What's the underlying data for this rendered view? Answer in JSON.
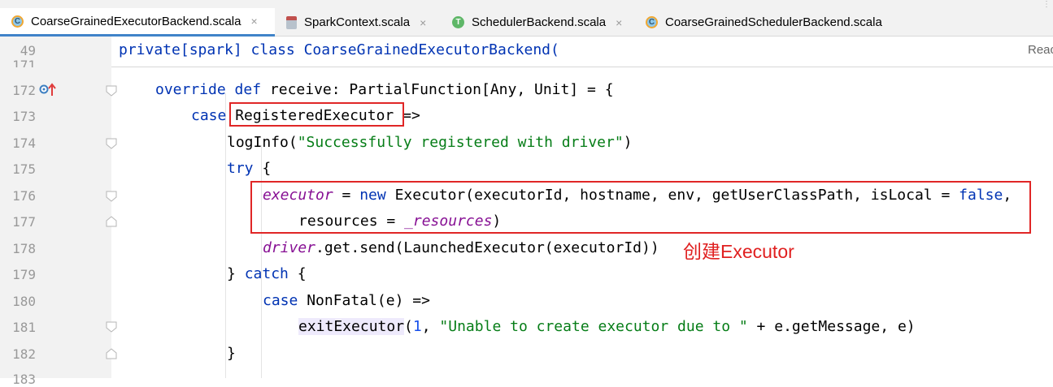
{
  "tabs": [
    {
      "label": "CoarseGrainedExecutorBackend.scala",
      "icon": "scala-class-icon",
      "active": true
    },
    {
      "label": "SparkContext.scala",
      "icon": "scala-file-icon",
      "active": false
    },
    {
      "label": "SchedulerBackend.scala",
      "icon": "scala-trait-icon",
      "active": false
    },
    {
      "label": "CoarseGrainedSchedulerBackend.scala",
      "icon": "scala-class-icon",
      "active": false
    }
  ],
  "tab_close": "×",
  "reader_mode": "Reac",
  "sticky_line": {
    "number": "49",
    "text": "private[spark] class CoarseGrainedExecutorBackend("
  },
  "partial_line_number": "171",
  "lines": [
    {
      "n": "172"
    },
    {
      "n": "173"
    },
    {
      "n": "174"
    },
    {
      "n": "175"
    },
    {
      "n": "176"
    },
    {
      "n": "177"
    },
    {
      "n": "178"
    },
    {
      "n": "179"
    },
    {
      "n": "180"
    },
    {
      "n": "181"
    },
    {
      "n": "182"
    },
    {
      "n": "183"
    }
  ],
  "code": {
    "l172": {
      "override": "override",
      "def": "def",
      "rest": " receive: PartialFunction[Any, Unit] = {"
    },
    "l173": {
      "case": "case",
      "name": "RegisteredExecutor",
      "arrow": " =>"
    },
    "l174": {
      "fn": "logInfo(",
      "str": "\"Successfully registered with driver\"",
      "close": ")"
    },
    "l175": {
      "try": "try",
      "rest": " {"
    },
    "l176": {
      "field": "executor",
      "eq": " = ",
      "new": "new",
      "mid": " Executor(executorId, hostname, env, getUserClassPath, isLocal = ",
      "false": "false",
      "comma": ","
    },
    "l177": {
      "pre": "resources = ",
      "field": "_resources",
      "close": ")"
    },
    "l178": {
      "field": "driver",
      "rest": ".get.send(LaunchedExecutor(executorId))"
    },
    "l179": {
      "open": "} ",
      "catch": "catch",
      "rest": " {"
    },
    "l180": {
      "case": "case",
      "rest": " NonFatal(e) =>"
    },
    "l181": {
      "fn": "exitExecutor",
      "open": "(",
      "num": "1",
      "sep": ", ",
      "str": "\"Unable to create executor due to \"",
      "rest": " + e.getMessage, e)"
    },
    "l182": {
      "close": "}"
    }
  },
  "annotation": "创建Executor",
  "colors": {
    "keyword": "#0033b3",
    "string": "#067d17",
    "field": "#871094",
    "number": "#1750eb",
    "annotation_red": "#e02626"
  }
}
